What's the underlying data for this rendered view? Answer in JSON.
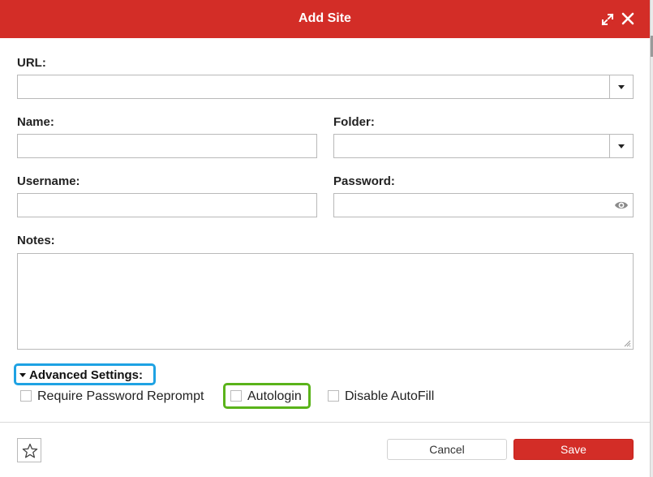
{
  "dialog": {
    "title": "Add Site",
    "expand_icon": "expand-arrows-icon",
    "close_icon": "close-icon"
  },
  "form": {
    "url": {
      "label": "URL:",
      "value": ""
    },
    "name": {
      "label": "Name:",
      "value": ""
    },
    "folder": {
      "label": "Folder:",
      "value": ""
    },
    "username": {
      "label": "Username:",
      "value": ""
    },
    "password": {
      "label": "Password:",
      "value": ""
    },
    "notes": {
      "label": "Notes:",
      "value": ""
    }
  },
  "advanced": {
    "label": "Advanced Settings:",
    "options": [
      {
        "label": "Require Password Reprompt",
        "checked": false
      },
      {
        "label": "Autologin",
        "checked": false
      },
      {
        "label": "Disable AutoFill",
        "checked": false
      }
    ]
  },
  "footer": {
    "favorite_icon": "star-icon",
    "cancel_label": "Cancel",
    "save_label": "Save"
  },
  "colors": {
    "brand_red": "#d32d27",
    "highlight_blue": "#1ea2e3",
    "highlight_green": "#5ab31a"
  }
}
